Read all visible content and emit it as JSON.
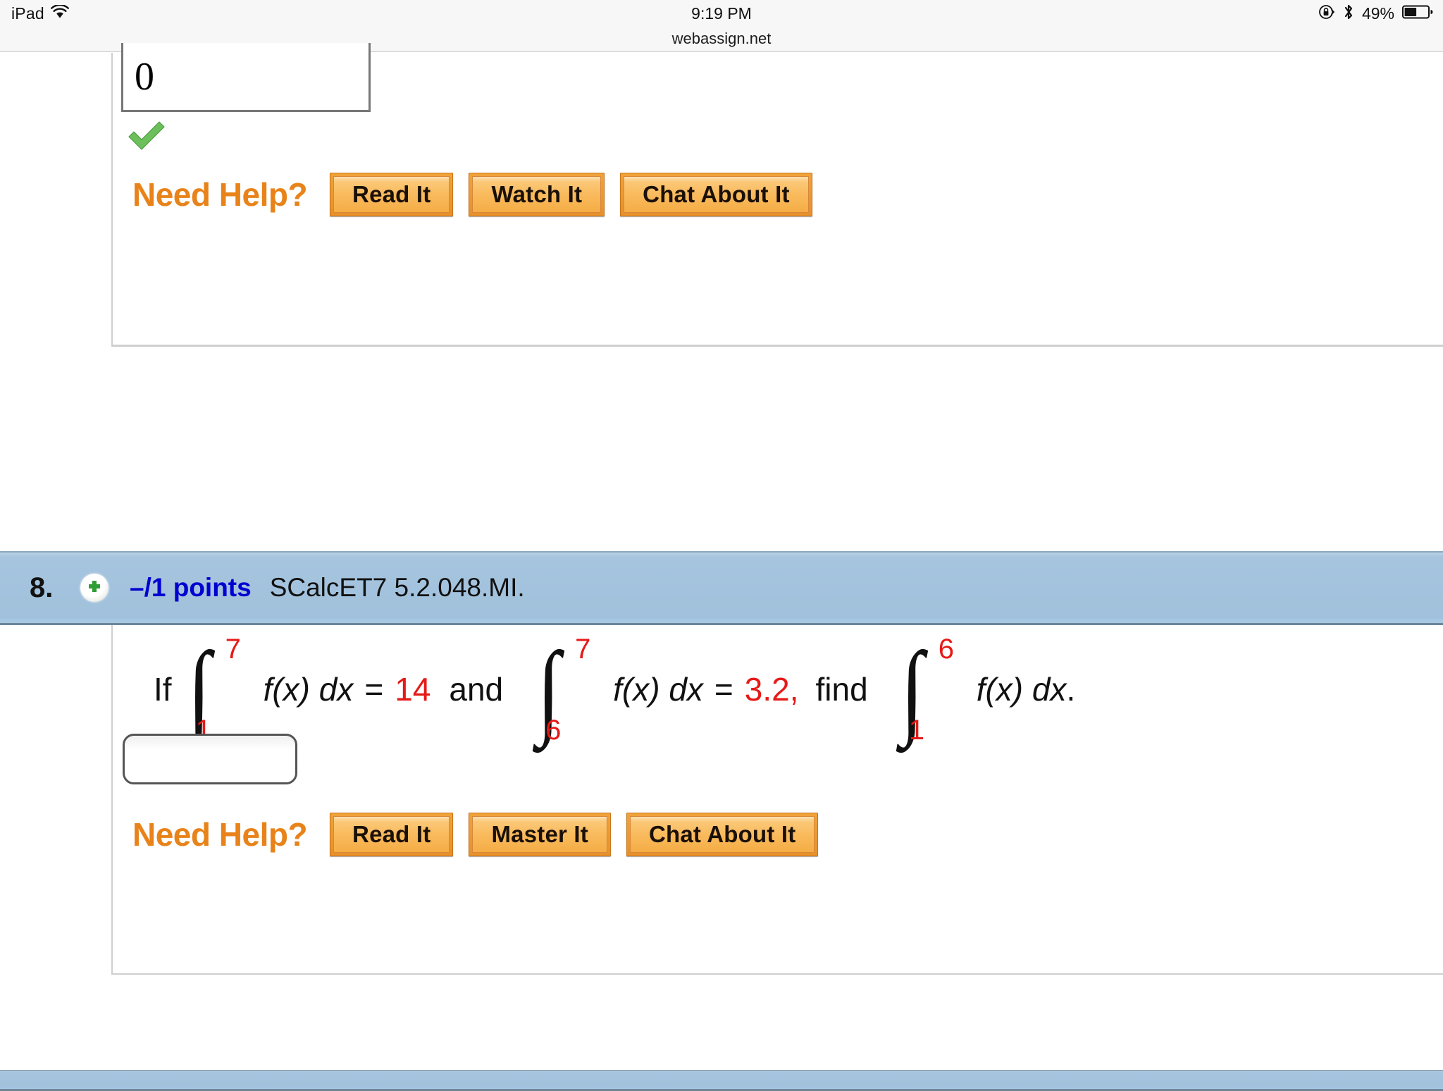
{
  "status_bar": {
    "device": "iPad",
    "wifi_icon": "wifi-icon",
    "time": "9:19 PM",
    "rotation_lock_icon": "rotation-lock-icon",
    "bluetooth_icon": "bluetooth-icon",
    "battery_percent": "49%",
    "battery_icon": "battery-icon"
  },
  "browser": {
    "url": "webassign.net"
  },
  "question_7": {
    "answer_box": {
      "value": "0",
      "status": "correct"
    },
    "check_icon": "green-checkmark-icon",
    "need_help": {
      "label": "Need Help?",
      "buttons": [
        "Read It",
        "Watch It",
        "Chat About It"
      ]
    }
  },
  "question_8": {
    "header": {
      "number": "8.",
      "expand_icon": "green-plus-icon",
      "points": "–/1 points",
      "code": "SCalcET7 5.2.048.MI."
    },
    "problem": {
      "lead": "If",
      "integral_1": {
        "lower": "1",
        "upper": "7",
        "integrand": "f(x) dx"
      },
      "equals_1": "=",
      "value_1": "14",
      "conjunction": "and",
      "integral_2": {
        "lower": "6",
        "upper": "7",
        "integrand": "f(x) dx"
      },
      "equals_2": "=",
      "value_2": "3.2,",
      "instruction": "find",
      "integral_3": {
        "lower": "1",
        "upper": "6",
        "integrand": "f(x) dx"
      },
      "terminator": "."
    },
    "answer_box": {
      "value": "",
      "placeholder": ""
    },
    "need_help": {
      "label": "Need Help?",
      "buttons": [
        "Read It",
        "Master It",
        "Chat About It"
      ]
    }
  },
  "colors": {
    "header_blue": "#A1C1DC",
    "points_blue": "#0000D0",
    "need_help_orange": "#E8831A",
    "math_red": "#E51A17",
    "button_orange": "#E8902A"
  }
}
